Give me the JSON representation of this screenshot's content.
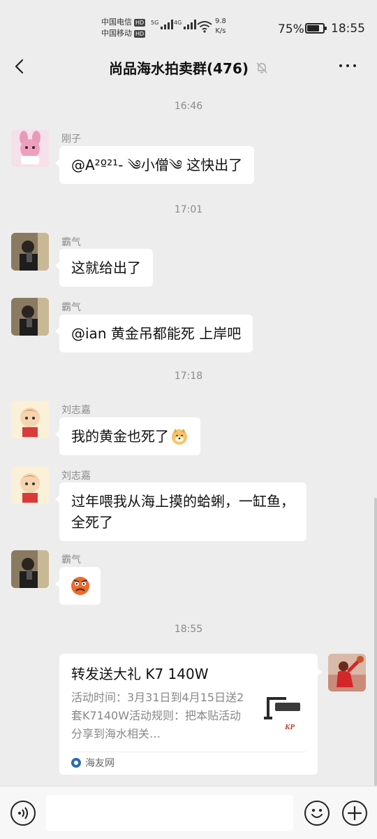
{
  "status_bar": {
    "carrier1": "中国电信",
    "carrier2": "中国移动",
    "hd_badge": "HD",
    "net1": "5G",
    "net2": "4G",
    "speed_value": "9.8",
    "speed_unit": "K/s",
    "battery_percent": "75%",
    "battery_level": 0.75,
    "time": "18:55"
  },
  "header": {
    "title": "尚品海水拍卖群(476)",
    "muted_icon": "bell-off-icon",
    "back_icon": "chevron-left-icon",
    "more_icon": "more-dots-icon"
  },
  "messages": [
    {
      "timestamp": "16:46"
    },
    {
      "sender": "刚子",
      "text": "@A²º²¹- ༄小僧༄ 这快出了"
    },
    {
      "timestamp": "17:01"
    },
    {
      "sender": "霸气",
      "text": "这就给出了"
    },
    {
      "sender": "霸气",
      "text": "@ian  黄金吊都能死 上岸吧"
    },
    {
      "timestamp": "17:18"
    },
    {
      "sender": "刘志嘉",
      "text": "我的黄金也死了"
    },
    {
      "sender": "刘志嘉",
      "text": "过年喂我从海上摸的蛤蜊，一缸鱼，全死了"
    },
    {
      "sender": "霸气",
      "sticker": "angry-face-emoji"
    },
    {
      "timestamp": "18:55"
    }
  ],
  "share_card": {
    "title": "转发送大礼 K7 140W",
    "description": "活动时间：3月31日到4月15日送2套K7140W活动规则：把本贴活动分享到海水相关…",
    "source": "海友网",
    "thumb_label": "KP"
  },
  "colors": {
    "background": "#ededed",
    "bubble": "#ffffff",
    "sender_name": "#8c8c8c"
  }
}
